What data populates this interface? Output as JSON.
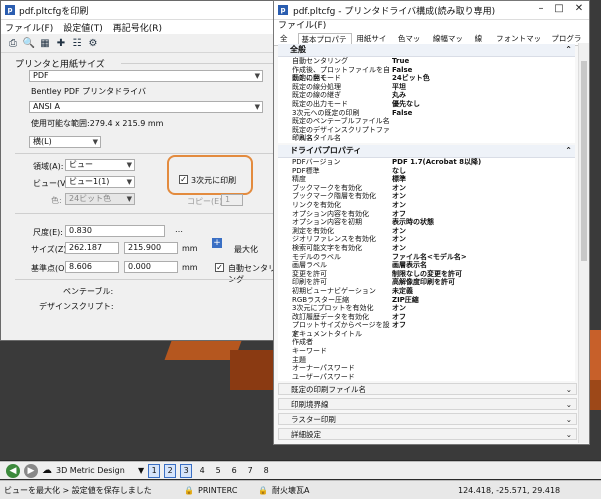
{
  "print_dialog": {
    "title": "pdf.pltcfgを印刷",
    "menu": [
      "ファイル(F)",
      "設定値(T)",
      "再記号化(R)"
    ],
    "printer_section": "プリンタと用紙サイズ",
    "printer": "PDF",
    "driver": "Bentley PDF プリンタドライバ",
    "paper": "ANSI A",
    "usable_area": "使用可能な範囲:279.4 x 215.9 mm",
    "orientation": "横(L)",
    "area_label": "領域(A):",
    "area_value": "ビュー",
    "view_label": "ビュー(V):",
    "view_value": "ビュー1(1)",
    "color_label": "色:",
    "color_value": "24ビット色",
    "print3d_label": "3次元に印刷",
    "copies_label": "コピー(E):",
    "copies_value": "1",
    "scale_label": "尺度(E):",
    "scale_value": "0.830",
    "size_label": "サイズ(Z):",
    "size_w": "262.187",
    "size_h": "215.900",
    "size_unit": "mm",
    "maximize_label": "最大化",
    "origin_label": "基準点(O):",
    "origin_x": "8.606",
    "origin_y": "0.000",
    "origin_unit": "mm",
    "auto_center_label": "自動センタリング",
    "pen_table_label": "ペンテーブル:",
    "design_script_label": "デザインスクリプト:"
  },
  "config_window": {
    "title": "pdf.pltcfg - プリンタドライバ構成(読み取り専用)",
    "menu": "ファイル(F)",
    "tabs": [
      "全般",
      "基本プロパティ",
      "用紙サイズ",
      "色マップ",
      "線幅マップ",
      "線種",
      "フォントマップ",
      "プログラム"
    ],
    "active_tab": "基本プロパティ",
    "general_header": "全般",
    "general_rows": [
      {
        "k": "自動センタリング",
        "v": "True"
      },
      {
        "k": "作成後、プロットファイルを自動的に開く",
        "v": "False"
      },
      {
        "k": "既定の色モード",
        "v": "24ビット色"
      },
      {
        "k": "既定の線分処理",
        "v": "平坦"
      },
      {
        "k": "既定の線の継ぎ",
        "v": "丸み"
      },
      {
        "k": "既定の出力モード",
        "v": "優先なし"
      },
      {
        "k": "3次元への既定の印刷",
        "v": "False"
      },
      {
        "k": "既定のペンテーブルファイル名",
        "v": ""
      },
      {
        "k": "既定のデザインスクリプトファイル名",
        "v": ""
      },
      {
        "k": "印刷スタイル名",
        "v": ""
      }
    ],
    "driver_header": "ドライバプロパティ",
    "driver_rows": [
      {
        "k": "PDFバージョン",
        "v": "PDF 1.7(Acrobat 8以降)"
      },
      {
        "k": "PDF標準",
        "v": "なし"
      },
      {
        "k": "精度",
        "v": "標準"
      },
      {
        "k": "ブックマークを有効化",
        "v": "オン"
      },
      {
        "k": "ブックマーク階層を有効化",
        "v": "オン"
      },
      {
        "k": "リンクを有効化",
        "v": "オン"
      },
      {
        "k": "オプション内容を有効化",
        "v": "オフ"
      },
      {
        "k": "オプション内容を初期",
        "v": "表示時の状態"
      },
      {
        "k": "測定を有効化",
        "v": "オン"
      },
      {
        "k": "ジオリファレンスを有効化",
        "v": "オン"
      },
      {
        "k": "検索可能文字を有効化",
        "v": "オン"
      },
      {
        "k": "モデルのラベル",
        "v": "ファイル名<モデル名>"
      },
      {
        "k": "画層ラベル",
        "v": "画層表示名"
      },
      {
        "k": "変更を許可",
        "v": "制限なしの変更を許可"
      },
      {
        "k": "印刷を許可",
        "v": "高解像度印刷を許可"
      },
      {
        "k": "初期ビューナビゲーション",
        "v": "未定義"
      },
      {
        "k": "RGBラスター圧縮",
        "v": "ZIP圧縮"
      },
      {
        "k": "3次元にプロットを有効化",
        "v": "オン"
      },
      {
        "k": "改訂履歴データを有効化",
        "v": "オフ"
      },
      {
        "k": "プロットサイズからページを設定",
        "v": "オフ"
      },
      {
        "k": "ドキュメントタイトル",
        "v": ""
      },
      {
        "k": "作成者",
        "v": ""
      },
      {
        "k": "キーワード",
        "v": ""
      },
      {
        "k": "主題",
        "v": ""
      },
      {
        "k": "オーナーパスワード",
        "v": ""
      },
      {
        "k": "ユーザーパスワード",
        "v": ""
      }
    ],
    "collapsed_sections": [
      "既定の印刷ファイル名",
      "印刷境界線",
      "ラスター印刷",
      "詳細設定"
    ]
  },
  "navbar": {
    "view_name": "3D Metric Design",
    "pages": [
      "1",
      "2",
      "3",
      "4",
      "5",
      "6",
      "7",
      "8"
    ]
  },
  "statusbar": {
    "message": "ビューを最大化 > 設定値を保存しました",
    "printer": "PRINTERC",
    "layer": "耐火壊瓦A",
    "coords": "124.418, -25.571, 29.418"
  },
  "colors": {
    "highlight_orange": "#e38b3e",
    "accent_blue": "#3a6fc4"
  },
  "icons": [
    "app-icon",
    "print-icon",
    "preview-icon",
    "fit-icon",
    "center-icon",
    "settings-icon",
    "maximize-icon",
    "back-icon",
    "forward-icon",
    "lock-icon"
  ]
}
